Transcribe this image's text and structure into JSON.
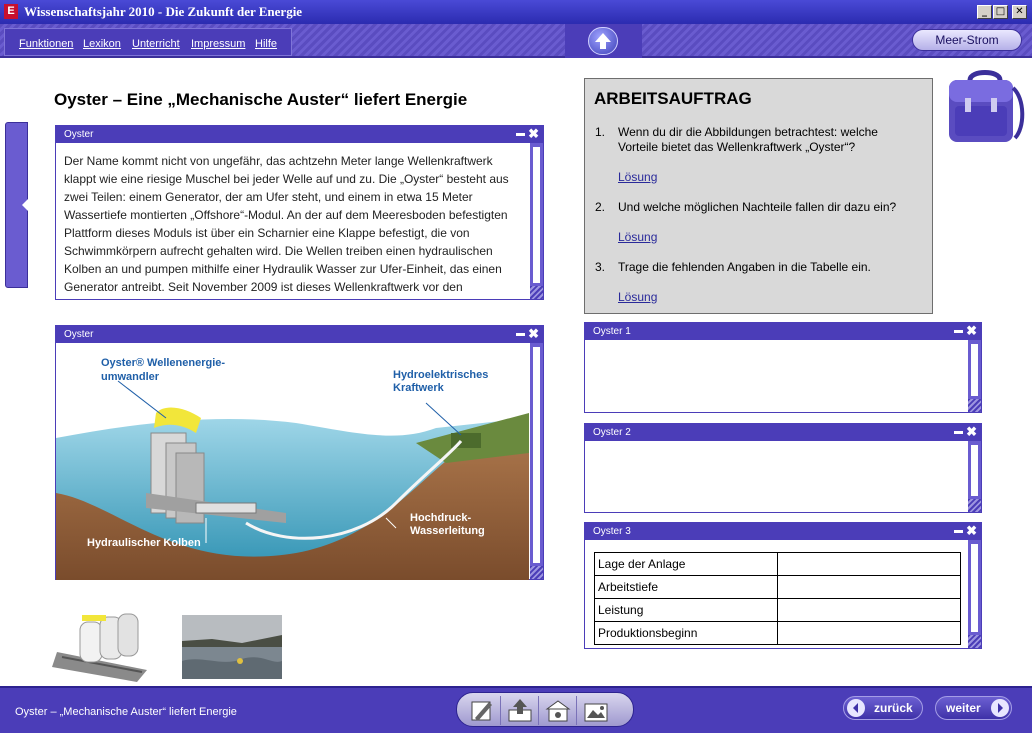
{
  "window": {
    "app_icon": "E",
    "title": "Wissenschaftsjahr 2010 - Die Zukunft der Energie",
    "minimize": "_",
    "maximize": "□",
    "close": "✕"
  },
  "menu": {
    "items": [
      "Funktionen",
      "Lexikon",
      "Unterricht",
      "Impressum",
      "Hilfe"
    ],
    "up_icon": "arrow-up-icon",
    "meer_strom": "Meer-Strom"
  },
  "page": {
    "heading": "Oyster – Eine „Mechanische Auster“ liefert Energie"
  },
  "text_panel": {
    "title": "Oyster",
    "body": "Der Name kommt nicht von ungefähr, das achtzehn Meter lange Wellenkraftwerk klappt wie eine riesige Muschel bei jeder Welle auf und zu. Die „Oyster“ besteht aus zwei Teilen: einem Generator, der am Ufer steht, und einem in etwa 15 Meter Wassertiefe montierten „Offshore“-Modul. An der auf dem Meeresboden befestigten Plattform dieses Moduls ist über ein Scharnier eine Klappe befestigt, die von Schwimmkörpern aufrecht gehalten wird. Die Wellen treiben einen hydraulischen Kolben an und pumpen mithilfe einer Hydraulik Wasser zur Ufer-Einheit, das einen Generator antreibt. Seit November 2009 ist dieses Wellenkraftwerk vor den"
  },
  "image_panel": {
    "title": "Oyster",
    "label_oyster_line1": "Oyster® Wellenenergie-",
    "label_oyster_line2": "umwandler",
    "label_kraftwerk_line1": "Hydroelektrisches",
    "label_kraftwerk_line2": "Kraftwerk",
    "label_kolben": "Hydraulischer Kolben",
    "label_leitung_line1": "Hochdruck-",
    "label_leitung_line2": "Wasserleitung"
  },
  "auftrag": {
    "heading": "ARBEITSAUFTRAG",
    "tasks": [
      {
        "num": "1.",
        "text": "Wenn du dir die Abbildungen betrachtest: welche Vorteile bietet das Wellenkraftwerk „Oyster“?",
        "link": "Lösung"
      },
      {
        "num": "2.",
        "text": "Und welche möglichen Nachteile fallen dir dazu ein?",
        "link": "Lösung"
      },
      {
        "num": "3.",
        "text": "Trage die fehlenden Angaben in die Tabelle ein.",
        "link": "Lösung"
      }
    ]
  },
  "oyster_panels": {
    "p1_title": "Oyster 1",
    "p2_title": "Oyster 2",
    "p3_title": "Oyster 3"
  },
  "table": {
    "rows": [
      {
        "label": "Lage der Anlage",
        "value": ""
      },
      {
        "label": "Arbeitstiefe",
        "value": ""
      },
      {
        "label": "Leistung",
        "value": ""
      },
      {
        "label": "Produktionsbeginn",
        "value": ""
      }
    ]
  },
  "footer": {
    "title": "Oyster – „Mechanische Auster“ liefert Energie",
    "tools": [
      "pencil-icon",
      "upload-icon",
      "camera-icon",
      "gallery-icon"
    ],
    "back": "zurück",
    "next": "weiter"
  }
}
